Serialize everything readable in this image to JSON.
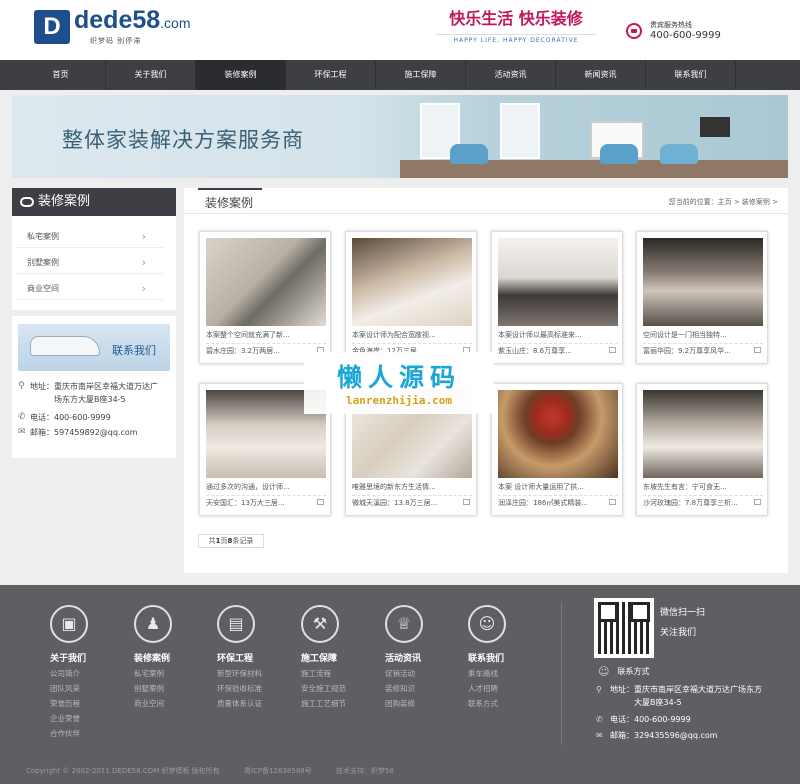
{
  "header": {
    "logo_main": "dede58",
    "logo_com": ".com",
    "logo_sub": "织梦码 别停滞",
    "slogan": "快乐生活 快乐装修",
    "slogan_en": "HAPPY LIFE, HAPPY DECORATIVE",
    "hotline_label": "贵宾服务热线",
    "hotline": "400-600-9999"
  },
  "nav": [
    "首页",
    "关于我们",
    "装修案例",
    "环保工程",
    "施工保障",
    "活动资讯",
    "新闻资讯",
    "联系我们"
  ],
  "nav_active": "装修案例",
  "banner": {
    "title": "整体家装解决方案服务商"
  },
  "sidebar": {
    "title": "装修案例",
    "items": [
      "私宅案例",
      "别墅案例",
      "商业空间"
    ],
    "contact_label": "联系我们",
    "address_label": "地址：",
    "address": "重庆市南岸区幸福大道万达广场东方大厦B座34-5",
    "phone_label": "电话：",
    "phone": "400-600-9999",
    "email_label": "邮箱：",
    "email": "597459892@qq.com"
  },
  "main": {
    "title": "装修案例",
    "breadcrumb": "您当前的位置：主页 > 装修案例 >",
    "cards": [
      {
        "cap": "本案整个空间就充满了新...",
        "sub": "碧水庄园：3.2万两居..."
      },
      {
        "cap": "本案设计师为配合宽敞视...",
        "sub": "金色海岸：12万三居..."
      },
      {
        "cap": "本案设计师以最高标准来...",
        "sub": "紫玉山庄：8.6万尊享..."
      },
      {
        "cap": "空间设计是一门相当独特...",
        "sub": "富丽华园：9.2万尊享风华..."
      },
      {
        "cap": "通过多次的沟通，设计师...",
        "sub": "天安国汇：13万大三居..."
      },
      {
        "cap": "唯雅思境的新东方生活情...",
        "sub": "微城天溪园：13.8万三居..."
      },
      {
        "cap": "本案 设计师大量运用了拱...",
        "sub": "润泽庄园：186㎡美式精装..."
      },
      {
        "cap": "东坡先生有言：宁可食无...",
        "sub": "沙河玫瑰园：7.8万尊享三析..."
      }
    ],
    "pager_pre": "共",
    "pager_num1": "1",
    "pager_mid": "页",
    "pager_num2": "8",
    "pager_post": "条记录"
  },
  "watermark": {
    "cn": "懒人源码",
    "en": "lanrenzhijia.com"
  },
  "footer": {
    "cols": [
      {
        "title": "关于我们",
        "icon": "picture-frame-icon",
        "links": [
          "公司简介",
          "团队风采",
          "荣誉历程",
          "企业荣誉",
          "合作伙伴"
        ]
      },
      {
        "title": "装修案例",
        "icon": "stamp-icon",
        "links": [
          "私宅案例",
          "别墅案例",
          "商业空间"
        ]
      },
      {
        "title": "环保工程",
        "icon": "paint-roller-icon",
        "links": [
          "新型环保材料",
          "环保验收标准",
          "质量体系认证"
        ]
      },
      {
        "title": "施工保障",
        "icon": "hammer-icon",
        "links": [
          "施工流程",
          "安全施工规范",
          "施工工艺细节"
        ]
      },
      {
        "title": "活动资讯",
        "icon": "trophy-icon",
        "links": [
          "促销活动",
          "装修知识",
          "团购装修"
        ]
      },
      {
        "title": "联系我们",
        "icon": "person-icon",
        "links": [
          "乘车路线",
          "人才招聘",
          "联系方式"
        ]
      }
    ],
    "qr_line1": "微信扫一扫",
    "qr_line2": "关注我们",
    "contact_title": "联系方式",
    "address_label": "地址：",
    "address1": "重庆市南岸区幸福大道万达广场东方",
    "address2": "大厦B座34-5",
    "phone_label": "电话：",
    "phone": "400-600-9999",
    "email_label": "邮箱：",
    "email": "329435596@qq.com"
  },
  "copyright": {
    "text": "Copyright © 2002-2011 DEDE58.COM 织梦模板 版权所有",
    "icp": "粤ICP备12638588号",
    "support": "技术支持：织梦58"
  }
}
